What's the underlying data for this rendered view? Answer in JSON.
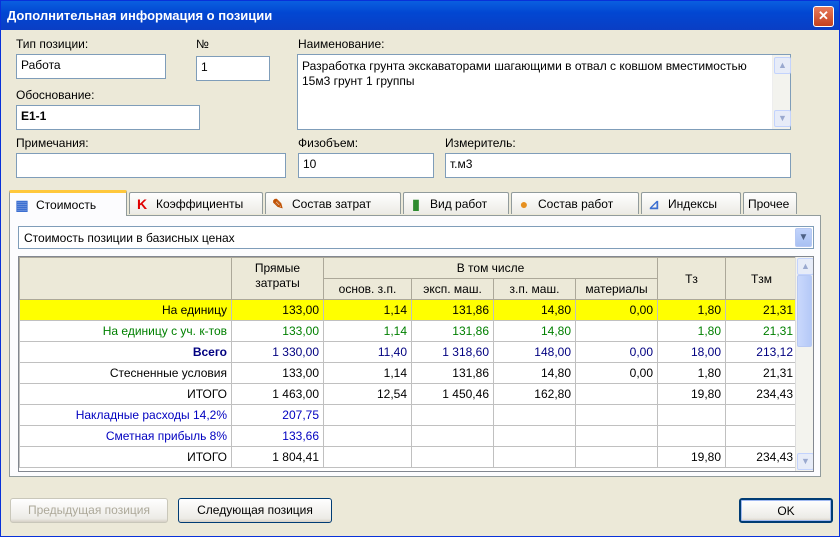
{
  "window": {
    "title": "Дополнительная информация о позиции",
    "close": "✕"
  },
  "form": {
    "type_label": "Тип позиции:",
    "type_value": "Работа",
    "num_label": "№",
    "num_value": "1",
    "name_label": "Наименование:",
    "name_value": "Разработка грунта экскаваторами шагающими в отвал с ковшом вместимостью 15м3 грунт 1 группы",
    "basis_label": "Обоснование:",
    "basis_value": "Е1-1",
    "notes_label": "Примечания:",
    "notes_value": "",
    "volume_label": "Физобъем:",
    "volume_value": "10",
    "unit_label": "Измеритель:",
    "unit_value": "т.м3"
  },
  "tabs": [
    {
      "label": "Стоимость",
      "icon": "cost-icon",
      "glyph": "▦"
    },
    {
      "label": "Коэффициенты",
      "icon": "k-letter-icon",
      "glyph": "K"
    },
    {
      "label": "Состав затрат",
      "icon": "chart-edit-icon",
      "glyph": "✎"
    },
    {
      "label": "Вид работ",
      "icon": "books-icon",
      "glyph": "▮"
    },
    {
      "label": "Состав работ",
      "icon": "person-icon",
      "glyph": "●"
    },
    {
      "label": "Индексы",
      "icon": "graph-icon",
      "glyph": "⊿"
    },
    {
      "label": "Прочее",
      "icon": "",
      "glyph": ""
    }
  ],
  "price_mode": {
    "selected": "Стоимость позиции в базисных ценах"
  },
  "table": {
    "headers": {
      "direct": "Прямые затраты",
      "including": "В том числе",
      "sub": [
        "основ. з.п.",
        "эксп. маш.",
        "з.п. маш.",
        "материалы"
      ],
      "tz": "Тз",
      "tzm": "Тзм"
    },
    "rows": [
      {
        "label": "На единицу",
        "cells": [
          "133,00",
          "1,14",
          "131,86",
          "14,80",
          "0,00",
          "1,80",
          "21,31"
        ]
      },
      {
        "label": "На единицу с уч. к-тов",
        "cells": [
          "133,00",
          "1,14",
          "131,86",
          "14,80",
          "",
          "1,80",
          "21,31"
        ]
      },
      {
        "label": "Всего",
        "cells": [
          "1 330,00",
          "11,40",
          "1 318,60",
          "148,00",
          "0,00",
          "18,00",
          "213,12"
        ]
      },
      {
        "label": "Стесненные условия",
        "cells": [
          "133,00",
          "1,14",
          "131,86",
          "14,80",
          "0,00",
          "1,80",
          "21,31"
        ]
      },
      {
        "label": "ИТОГО",
        "cells": [
          "1 463,00",
          "12,54",
          "1 450,46",
          "162,80",
          "",
          "19,80",
          "234,43"
        ]
      },
      {
        "label": "Накладные расходы 14,2%",
        "cells": [
          "207,75",
          "",
          "",
          "",
          "",
          "",
          ""
        ]
      },
      {
        "label": "Сметная прибыль 8%",
        "cells": [
          "133,66",
          "",
          "",
          "",
          "",
          "",
          ""
        ]
      },
      {
        "label": "ИТОГО",
        "cells": [
          "1 804,41",
          "",
          "",
          "",
          "",
          "19,80",
          "234,43"
        ]
      }
    ]
  },
  "buttons": {
    "prev": "Предыдущая позиция",
    "next": "Следующая позиция",
    "ok": "OK"
  },
  "colors": {
    "highlight": "#ffff00",
    "green_text": "#008000",
    "blue_text": "#0000c0"
  }
}
